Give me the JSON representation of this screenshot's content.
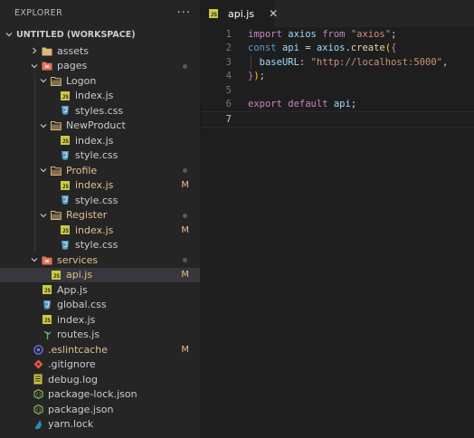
{
  "explorer": {
    "title": "EXPLORER",
    "more": "···",
    "workspace": "UNTITLED (WORKSPACE)",
    "items": [
      {
        "label": "assets",
        "type": "folder",
        "depth": 1,
        "open": false
      },
      {
        "label": "pages",
        "type": "folder-special",
        "depth": 1,
        "open": true,
        "dot": true
      },
      {
        "label": "Logon",
        "type": "folder",
        "depth": 2,
        "open": true
      },
      {
        "label": "index.js",
        "type": "js",
        "depth": 3
      },
      {
        "label": "styles.css",
        "type": "css",
        "depth": 3
      },
      {
        "label": "NewProduct",
        "type": "folder",
        "depth": 2,
        "open": true
      },
      {
        "label": "index.js",
        "type": "js",
        "depth": 3
      },
      {
        "label": "style.css",
        "type": "css",
        "depth": 3
      },
      {
        "label": "Profile",
        "type": "folder",
        "depth": 2,
        "open": true,
        "dot": true,
        "state": "modified"
      },
      {
        "label": "index.js",
        "type": "js",
        "depth": 3,
        "badge": "M",
        "state": "modified"
      },
      {
        "label": "style.css",
        "type": "css",
        "depth": 3
      },
      {
        "label": "Register",
        "type": "folder",
        "depth": 2,
        "open": true,
        "dot": true,
        "state": "modified"
      },
      {
        "label": "index.js",
        "type": "js",
        "depth": 3,
        "badge": "M",
        "state": "modified"
      },
      {
        "label": "style.css",
        "type": "css",
        "depth": 3
      },
      {
        "label": "services",
        "type": "folder-special",
        "depth": 1,
        "open": true,
        "dot": true,
        "state": "modified"
      },
      {
        "label": "api.js",
        "type": "js",
        "depth": 2,
        "badge": "M",
        "state": "modified",
        "selected": true
      },
      {
        "label": "App.js",
        "type": "js",
        "depth": 1
      },
      {
        "label": "global.css",
        "type": "css",
        "depth": 1
      },
      {
        "label": "index.js",
        "type": "js",
        "depth": 1
      },
      {
        "label": "routes.js",
        "type": "routes",
        "depth": 1
      },
      {
        "label": ".eslintcache",
        "type": "eslint",
        "depth": 0,
        "badge": "M",
        "state": "modified"
      },
      {
        "label": ".gitignore",
        "type": "git",
        "depth": 0
      },
      {
        "label": "debug.log",
        "type": "log",
        "depth": 0
      },
      {
        "label": "package-lock.json",
        "type": "npm",
        "depth": 0
      },
      {
        "label": "package.json",
        "type": "npm",
        "depth": 0
      },
      {
        "label": "yarn.lock",
        "type": "yarn",
        "depth": 0
      }
    ]
  },
  "tabs": [
    {
      "label": "api.js",
      "close": "✕"
    }
  ],
  "code": {
    "current_line": 7,
    "lines": [
      {
        "n": "1",
        "tokens": [
          [
            "kw",
            "import"
          ],
          [
            "pn",
            " "
          ],
          [
            "id",
            "axios"
          ],
          [
            "pn",
            " "
          ],
          [
            "kw",
            "from"
          ],
          [
            "pn",
            " "
          ],
          [
            "str",
            "\"axios\""
          ],
          [
            "pn",
            ";"
          ]
        ]
      },
      {
        "n": "2",
        "tokens": [
          [
            "kw2",
            "const"
          ],
          [
            "pn",
            " "
          ],
          [
            "id",
            "api"
          ],
          [
            "pn",
            " = "
          ],
          [
            "id",
            "axios"
          ],
          [
            "pn",
            "."
          ],
          [
            "fn",
            "create"
          ],
          [
            "paren",
            "("
          ],
          [
            "brace",
            "{"
          ]
        ]
      },
      {
        "n": "3",
        "tokens": [
          [
            "pn",
            "  "
          ],
          [
            "id",
            "baseURL"
          ],
          [
            "pn",
            ": "
          ],
          [
            "str",
            "\"http://localhost:5000\""
          ],
          [
            "pn",
            ","
          ]
        ],
        "guide": true
      },
      {
        "n": "4",
        "tokens": [
          [
            "brace",
            "}"
          ],
          [
            "paren",
            ")"
          ],
          [
            "pn",
            ";"
          ]
        ]
      },
      {
        "n": "5",
        "tokens": []
      },
      {
        "n": "6",
        "tokens": [
          [
            "kw",
            "export"
          ],
          [
            "pn",
            " "
          ],
          [
            "kw",
            "default"
          ],
          [
            "pn",
            " "
          ],
          [
            "id",
            "api"
          ],
          [
            "pn",
            ";"
          ]
        ]
      },
      {
        "n": "7",
        "tokens": []
      }
    ]
  },
  "colors": {
    "folder": "#dcb67a",
    "folder_special": "#e8735a",
    "js": "#cbcb41",
    "css": "#519aba",
    "modified": "#e2c08d"
  }
}
